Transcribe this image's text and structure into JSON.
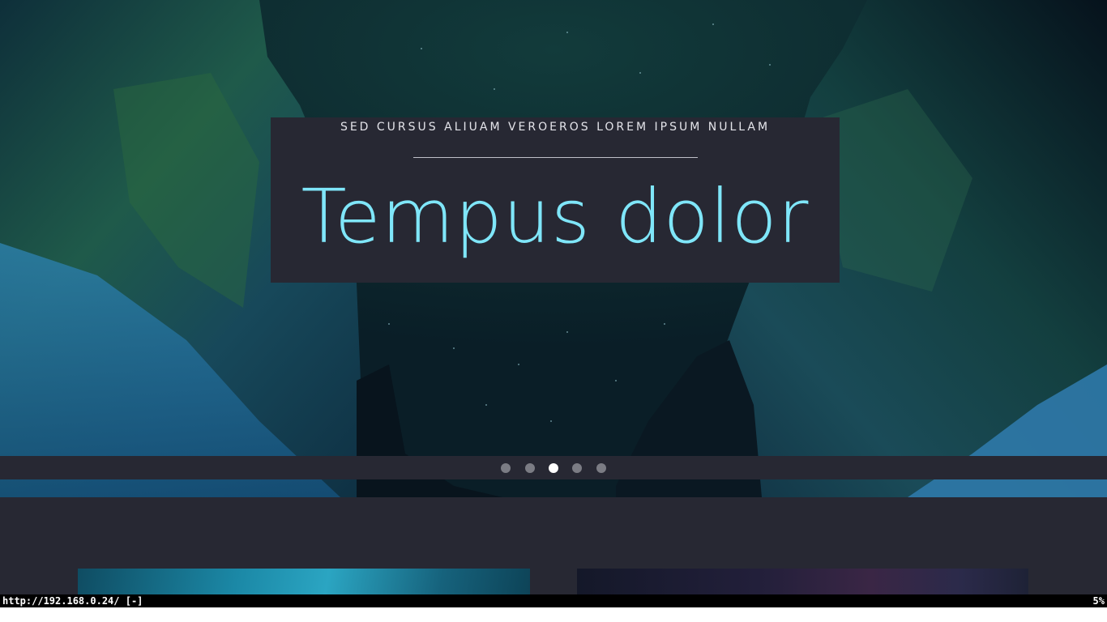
{
  "hero": {
    "subtitle": "SED CURSUS ALIUAM VEROEROS LOREM IPSUM NULLAM",
    "title": "Tempus dolor",
    "title_color": "#7fe6f9",
    "slides": [
      {
        "label": "slide-1",
        "active": false
      },
      {
        "label": "slide-2",
        "active": false
      },
      {
        "label": "slide-3",
        "active": true
      },
      {
        "label": "slide-4",
        "active": false
      },
      {
        "label": "slide-5",
        "active": false
      }
    ]
  },
  "status": {
    "url": "http://192.168.0.24/ [-]",
    "scroll_percent": "5%"
  },
  "colors": {
    "panel": "#272833",
    "accent": "#7fe6f9",
    "dot_inactive": "#7b7c84",
    "dot_active": "#ffffff"
  }
}
